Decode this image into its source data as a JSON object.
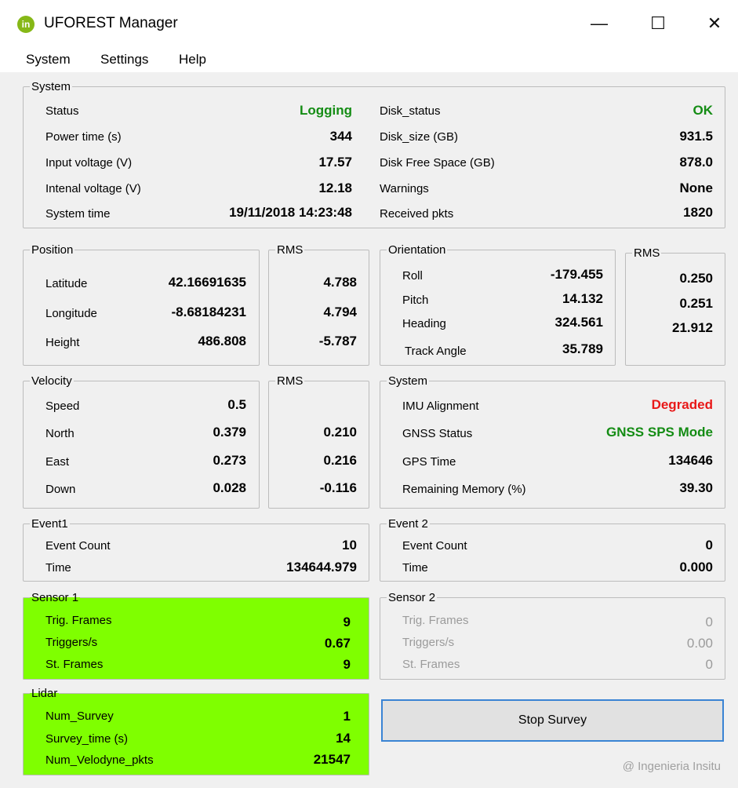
{
  "window": {
    "title": "UFOREST Manager",
    "icon": "in",
    "controls": {
      "minimize": "—",
      "maximize": "☐",
      "close": "✕"
    }
  },
  "menu": [
    "System",
    "Settings",
    "Help"
  ],
  "system": {
    "legend": "System",
    "left": [
      {
        "label": "Status",
        "value": "Logging"
      },
      {
        "label": "Power time (s)",
        "value": "344"
      },
      {
        "label": "Input voltage (V)",
        "value": "17.57"
      },
      {
        "label": "Intenal voltage (V)",
        "value": "12.18"
      },
      {
        "label": "System time",
        "value": "19/11/2018 14:23:48"
      }
    ],
    "right": [
      {
        "label": "Disk_status",
        "value": "OK"
      },
      {
        "label": "Disk_size (GB)",
        "value": "931.5"
      },
      {
        "label": "Disk Free Space (GB)",
        "value": "878.0"
      },
      {
        "label": "Warnings",
        "value": "None"
      },
      {
        "label": "Received pkts",
        "value": "1820"
      }
    ]
  },
  "position": {
    "legend": "Position",
    "rms_legend": "RMS",
    "rows": [
      {
        "label": "Latitude",
        "value": "42.16691635",
        "rms": "4.788"
      },
      {
        "label": "Longitude",
        "value": "-8.68184231",
        "rms": "4.794"
      },
      {
        "label": "Height",
        "value": "486.808",
        "rms": "-5.787"
      }
    ]
  },
  "orientation": {
    "legend": "Orientation",
    "rms_legend": "RMS",
    "rows": [
      {
        "label": "Roll",
        "value": "-179.455",
        "rms": "0.250"
      },
      {
        "label": "Pitch",
        "value": "14.132",
        "rms": "0.251"
      },
      {
        "label": "Heading",
        "value": "324.561",
        "rms": "21.912"
      },
      {
        "label": "Track Angle",
        "value": "35.789"
      }
    ]
  },
  "velocity": {
    "legend": "Velocity",
    "rms_legend": "RMS",
    "rows": [
      {
        "label": "Speed",
        "value": "0.5"
      },
      {
        "label": "North",
        "value": "0.379",
        "rms": "0.210"
      },
      {
        "label": "East",
        "value": "0.273",
        "rms": "0.216"
      },
      {
        "label": "Down",
        "value": "0.028",
        "rms": "-0.116"
      }
    ]
  },
  "ins_system": {
    "legend": "System",
    "rows": [
      {
        "label": "IMU Alignment",
        "value": "Degraded"
      },
      {
        "label": "GNSS Status",
        "value": "GNSS SPS Mode"
      },
      {
        "label": "GPS Time",
        "value": "134646"
      },
      {
        "label": "Remaining Memory (%)",
        "value": "39.30"
      }
    ]
  },
  "event1": {
    "legend": "Event1",
    "rows": [
      {
        "label": "Event Count",
        "value": "10"
      },
      {
        "label": "Time",
        "value": "134644.979"
      }
    ]
  },
  "event2": {
    "legend": "Event 2",
    "rows": [
      {
        "label": "Event Count",
        "value": "0"
      },
      {
        "label": "Time",
        "value": "0.000"
      }
    ]
  },
  "sensor1": {
    "legend": "Sensor 1",
    "rows": [
      {
        "label": "Trig. Frames",
        "value": "9"
      },
      {
        "label": "Triggers/s",
        "value": "0.67"
      },
      {
        "label": "St. Frames",
        "value": "9"
      }
    ]
  },
  "sensor2": {
    "legend": "Sensor 2",
    "rows": [
      {
        "label": "Trig. Frames",
        "value": "0"
      },
      {
        "label": "Triggers/s",
        "value": "0.00"
      },
      {
        "label": "St. Frames",
        "value": "0"
      }
    ]
  },
  "lidar": {
    "legend": "Lidar",
    "rows": [
      {
        "label": "Num_Survey",
        "value": "1"
      },
      {
        "label": "Survey_time (s)",
        "value": "14"
      },
      {
        "label": "Num_Velodyne_pkts",
        "value": "21547"
      }
    ]
  },
  "stop_button": "Stop Survey",
  "copyright": "@ Ingenieria Insitu",
  "colors": {
    "ok_green": "#148c14",
    "alert_red": "#e81818",
    "highlight_green": "#7fff00",
    "disabled_grey": "#9b9b9b"
  }
}
